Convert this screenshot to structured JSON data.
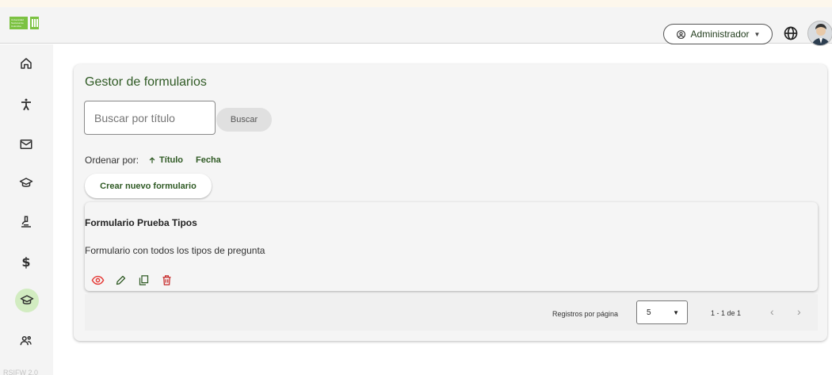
{
  "header": {
    "logo_text": "Universidad Nacional de Colombia",
    "role_label": "Administrador",
    "colors": {
      "brand": "#7cc242",
      "accent": "#2f5a24",
      "delete": "#c62828",
      "view": "#e53935"
    }
  },
  "sidebar": {
    "items": [
      {
        "icon": "home-icon"
      },
      {
        "icon": "accessibility-icon"
      },
      {
        "icon": "mail-icon"
      },
      {
        "icon": "graduation-cap-icon"
      },
      {
        "icon": "microscope-icon"
      },
      {
        "icon": "dollar-icon",
        "glyph": "$"
      },
      {
        "icon": "graduation-cap-icon",
        "active": true
      },
      {
        "icon": "group-icon"
      }
    ],
    "version": "RSIFW 2.0"
  },
  "main": {
    "title": "Gestor de formularios",
    "search": {
      "placeholder": "Buscar por título",
      "button": "Buscar"
    },
    "sort": {
      "label": "Ordenar por:",
      "options": [
        "Título",
        "Fecha"
      ],
      "active": "Título",
      "direction": "asc"
    },
    "create_button": "Crear nuevo formulario",
    "forms": [
      {
        "title": "Formulario Prueba Tipos",
        "description": "Formulario con todos los tipos de pregunta"
      }
    ],
    "pagination": {
      "label": "Registros por página",
      "page_size": "5",
      "range": "1 - 1 de 1",
      "prev": "‹",
      "next": "›"
    }
  }
}
